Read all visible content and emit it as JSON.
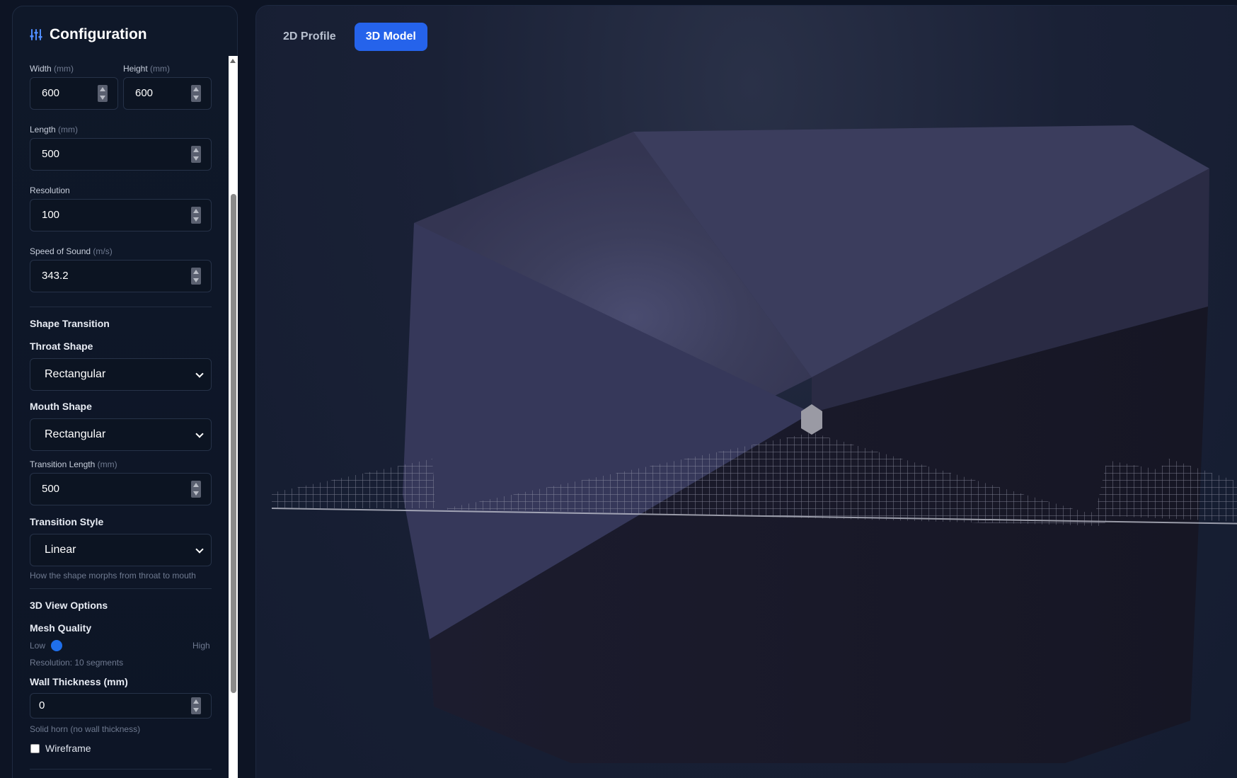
{
  "sidebar": {
    "title": "Configuration",
    "fields": {
      "width": {
        "label": "Width",
        "unit": "(mm)",
        "value": "600"
      },
      "height": {
        "label": "Height",
        "unit": "(mm)",
        "value": "600"
      },
      "length": {
        "label": "Length",
        "unit": "(mm)",
        "value": "500"
      },
      "resolution": {
        "label": "Resolution",
        "value": "100"
      },
      "speed": {
        "label": "Speed of Sound",
        "unit": "(m/s)",
        "value": "343.2"
      }
    },
    "shape_transition": {
      "heading": "Shape Transition",
      "throat_label": "Throat Shape",
      "throat_value": "Rectangular",
      "mouth_label": "Mouth Shape",
      "mouth_value": "Rectangular",
      "transition_length_label": "Transition Length",
      "transition_length_unit": "(mm)",
      "transition_length_value": "500",
      "style_label": "Transition Style",
      "style_value": "Linear",
      "style_hint": "How the shape morphs from throat to mouth"
    },
    "view_options": {
      "heading": "3D View Options",
      "mesh_label": "Mesh Quality",
      "low": "Low",
      "high": "High",
      "mesh_level": 0,
      "mesh_hint": "Resolution: 10 segments",
      "wall_label": "Wall Thickness (mm)",
      "wall_value": "0",
      "wall_hint": "Solid horn (no wall thickness)",
      "wireframe_label": "Wireframe",
      "wireframe_checked": false
    }
  },
  "main": {
    "tabs": [
      {
        "label": "2D Profile",
        "active": false
      },
      {
        "label": "3D Model",
        "active": true
      }
    ]
  },
  "colors": {
    "accent": "#2563eb",
    "panel": "#0f1829",
    "horn_light": "#3d3f5e",
    "horn_dark": "#151524"
  }
}
